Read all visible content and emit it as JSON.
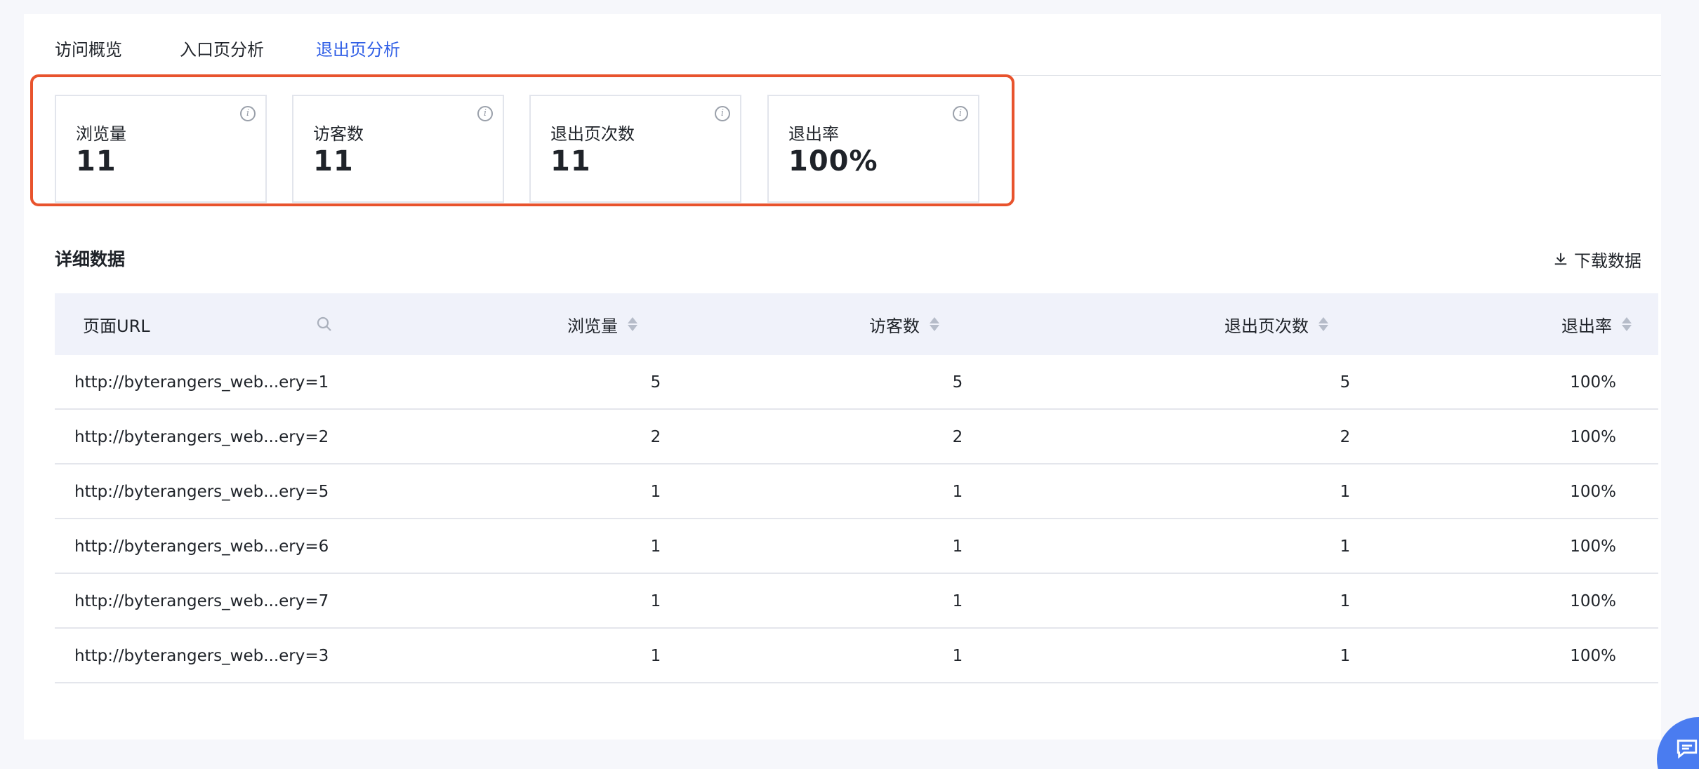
{
  "tabs": [
    {
      "label": "访问概览",
      "active": false
    },
    {
      "label": "入口页分析",
      "active": false
    },
    {
      "label": "退出页分析",
      "active": true
    }
  ],
  "metrics": [
    {
      "label": "浏览量",
      "value": "11",
      "info": "i"
    },
    {
      "label": "访客数",
      "value": "11",
      "info": "i"
    },
    {
      "label": "退出页次数",
      "value": "11",
      "info": "i"
    },
    {
      "label": "退出率",
      "value": "100%",
      "info": "i"
    }
  ],
  "detail": {
    "title": "详细数据",
    "download_label": "下载数据",
    "download_icon": "download-icon"
  },
  "table": {
    "headers": {
      "url": "页面URL",
      "pv": "浏览量",
      "uv": "访客数",
      "exit_count": "退出页次数",
      "exit_rate": "退出率"
    },
    "rows": [
      {
        "url": "http://byterangers_web...ery=1",
        "pv": "5",
        "uv": "5",
        "exit_count": "5",
        "exit_rate": "100%"
      },
      {
        "url": "http://byterangers_web...ery=2",
        "pv": "2",
        "uv": "2",
        "exit_count": "2",
        "exit_rate": "100%"
      },
      {
        "url": "http://byterangers_web...ery=5",
        "pv": "1",
        "uv": "1",
        "exit_count": "1",
        "exit_rate": "100%"
      },
      {
        "url": "http://byterangers_web...ery=6",
        "pv": "1",
        "uv": "1",
        "exit_count": "1",
        "exit_rate": "100%"
      },
      {
        "url": "http://byterangers_web...ery=7",
        "pv": "1",
        "uv": "1",
        "exit_count": "1",
        "exit_rate": "100%"
      },
      {
        "url": "http://byterangers_web...ery=3",
        "pv": "1",
        "uv": "1",
        "exit_count": "1",
        "exit_rate": "100%"
      }
    ]
  },
  "colors": {
    "accent": "#2f5ee6",
    "highlight_border": "#e8532d",
    "table_header_bg": "#f0f2fa",
    "chat_bubble": "#4a7cf0"
  }
}
